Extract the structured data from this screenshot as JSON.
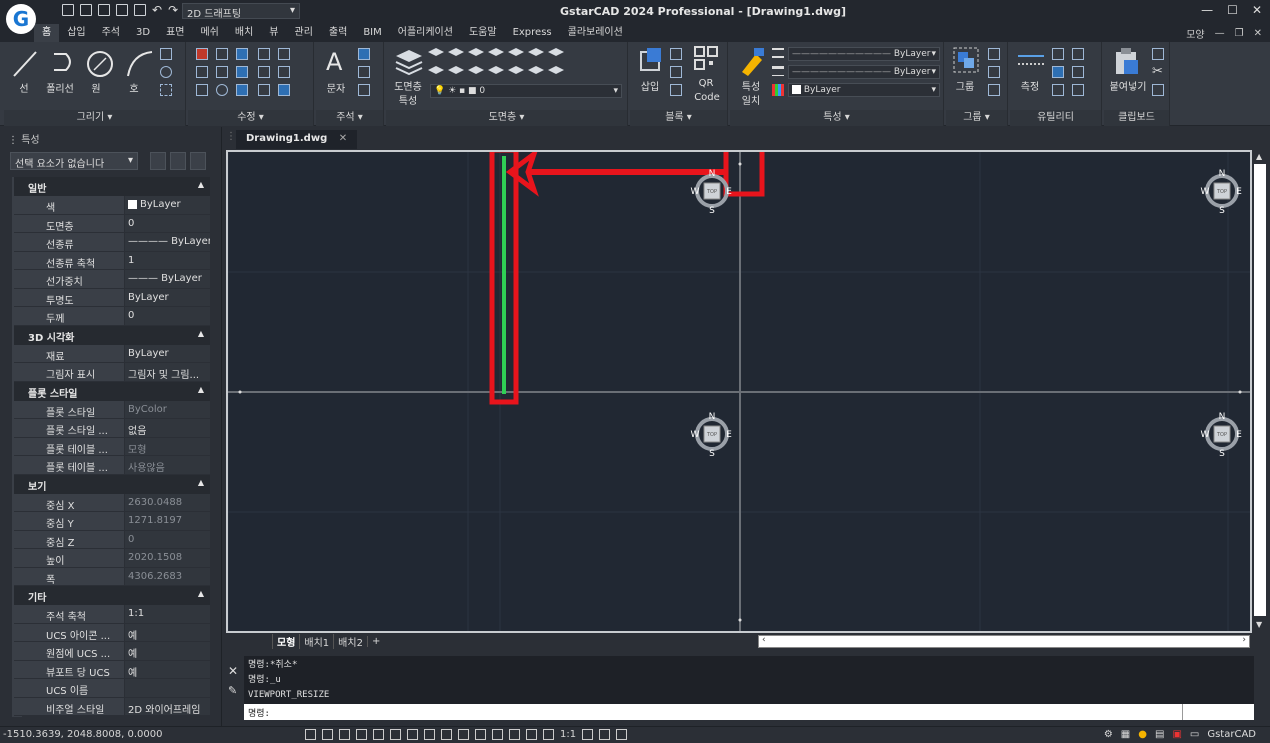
{
  "app": {
    "logo_letter": "G",
    "workspace": "2D 드래프팅",
    "title": "GstarCAD 2024 Professional - [Drawing1.dwg]",
    "right_menu": "모양",
    "win_controls": [
      "—",
      "☐",
      "✕"
    ]
  },
  "ribbon_tabs": [
    "홈",
    "삽입",
    "주석",
    "3D",
    "표면",
    "메쉬",
    "배치",
    "뷰",
    "관리",
    "출력",
    "BIM",
    "어플리케이션",
    "도움말",
    "Express",
    "콜라보레이션"
  ],
  "ribbon": {
    "draw": {
      "footer": "그리기",
      "line": "선",
      "polyline": "폴리선",
      "circle": "원",
      "arc": "호"
    },
    "modify": {
      "footer": "수정"
    },
    "annotation": {
      "footer": "주석",
      "text": "문자"
    },
    "layers": {
      "footer": "도면층",
      "props_label_1": "도면층",
      "props_label_2": "특성",
      "layer_value": "0"
    },
    "block": {
      "footer": "블록",
      "insert": "삽입",
      "qr_1": "QR",
      "qr_2": "Code"
    },
    "properties": {
      "footer": "특성",
      "match_1": "특성",
      "match_2": "일치",
      "bylayer_1": "ByLayer",
      "bylayer_2": "ByLayer",
      "bylayer_3": "ByLayer"
    },
    "groups": {
      "footer": "그룹",
      "group": "그룹"
    },
    "utilities": {
      "footer": "유틸리티",
      "measure": "측정"
    },
    "clipboard": {
      "footer": "클립보드",
      "paste": "붙여넣기"
    }
  },
  "properties_palette": {
    "title": "특성",
    "selection": "선택 요소가 없습니다",
    "sections": [
      {
        "name": "일반",
        "rows": [
          {
            "k": "색",
            "v": "ByLayer",
            "swatch": true
          },
          {
            "k": "도면층",
            "v": "0"
          },
          {
            "k": "선종류",
            "v": "———— ByLayer"
          },
          {
            "k": "선종류 축척",
            "v": "1"
          },
          {
            "k": "선가중치",
            "v": "——— ByLayer"
          },
          {
            "k": "투명도",
            "v": "ByLayer"
          },
          {
            "k": "두께",
            "v": "0"
          }
        ]
      },
      {
        "name": "3D 시각화",
        "rows": [
          {
            "k": "재료",
            "v": "ByLayer"
          },
          {
            "k": "그림자 표시",
            "v": "그림자 및 그림..."
          }
        ]
      },
      {
        "name": "플롯 스타일",
        "rows": [
          {
            "k": "플롯 스타일",
            "v": "ByColor",
            "dim": true
          },
          {
            "k": "플롯 스타일 ...",
            "v": "없음"
          },
          {
            "k": "플롯 테이블 ...",
            "v": "모형",
            "dim": true
          },
          {
            "k": "플롯 테이블 ...",
            "v": "사용않음",
            "dim": true
          }
        ]
      },
      {
        "name": "보기",
        "rows": [
          {
            "k": "중심 X",
            "v": "2630.0488",
            "dim": true
          },
          {
            "k": "중심 Y",
            "v": "1271.8197",
            "dim": true
          },
          {
            "k": "중심 Z",
            "v": "0",
            "dim": true
          },
          {
            "k": "높이",
            "v": "2020.1508",
            "dim": true
          },
          {
            "k": "폭",
            "v": "4306.2683",
            "dim": true
          }
        ]
      },
      {
        "name": "기타",
        "rows": [
          {
            "k": "주석 축척",
            "v": "1:1"
          },
          {
            "k": "UCS 아이콘 ...",
            "v": "예"
          },
          {
            "k": "원점에 UCS ...",
            "v": "예"
          },
          {
            "k": "뷰포트 당 UCS",
            "v": "예"
          },
          {
            "k": "UCS 이름",
            "v": ""
          },
          {
            "k": "비주얼 스타일",
            "v": "2D 와이어프레임"
          }
        ]
      }
    ]
  },
  "document": {
    "tab": "Drawing1.dwg"
  },
  "layout_tabs": [
    "모형",
    "배치1",
    "배치2",
    "+"
  ],
  "compass": {
    "n": "N",
    "s": "S",
    "e": "E",
    "w": "W",
    "top": "TOP"
  },
  "command": {
    "lines": [
      "명령:*취소*",
      "명령:_u",
      "VIEWPORT_RESIZE"
    ],
    "prompt": "명령:"
  },
  "status": {
    "coords": "-1510.3639, 2048.8008, 0.0000",
    "scale": "1:1",
    "product": "GstarCAD"
  },
  "colors": {
    "annotation": "#e8141c",
    "highlight_line": "#2fcf55",
    "canvas": "#212833"
  }
}
